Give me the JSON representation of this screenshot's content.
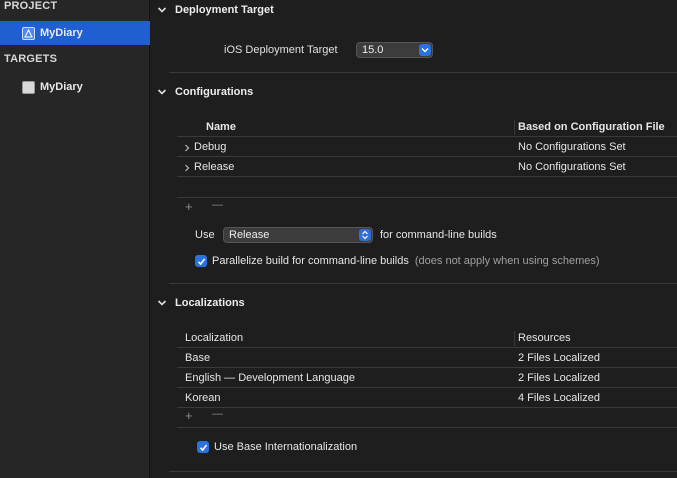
{
  "sidebar": {
    "project_header": "PROJECT",
    "project_item": "MyDiary",
    "targets_header": "TARGETS",
    "target_item": "MyDiary"
  },
  "deployment": {
    "title": "Deployment Target",
    "label": "iOS Deployment Target",
    "value": "15.0"
  },
  "configurations": {
    "title": "Configurations",
    "columns": [
      "Name",
      "Based on Configuration File"
    ],
    "rows": [
      {
        "name": "Debug",
        "file": "No Configurations Set"
      },
      {
        "name": "Release",
        "file": "No Configurations Set"
      }
    ],
    "use_label": "Use",
    "use_value": "Release",
    "use_suffix": "for command-line builds",
    "parallelize_label": "Parallelize build for command-line builds",
    "parallelize_note": "(does not apply when using schemes)",
    "parallelize_checked": true
  },
  "localizations": {
    "title": "Localizations",
    "columns": [
      "Localization",
      "Resources"
    ],
    "rows": [
      {
        "name": "Base",
        "resources": "2 Files Localized"
      },
      {
        "name": "English — Development Language",
        "resources": "2 Files Localized"
      },
      {
        "name": "Korean",
        "resources": "4 Files Localized"
      }
    ],
    "base_intl_label": "Use Base Internationalization",
    "base_intl_checked": true
  },
  "controls": {
    "plus": "+",
    "minus": "—"
  },
  "colors": {
    "accent": "#1f5fd1",
    "checkbox": "#2a72e0"
  }
}
